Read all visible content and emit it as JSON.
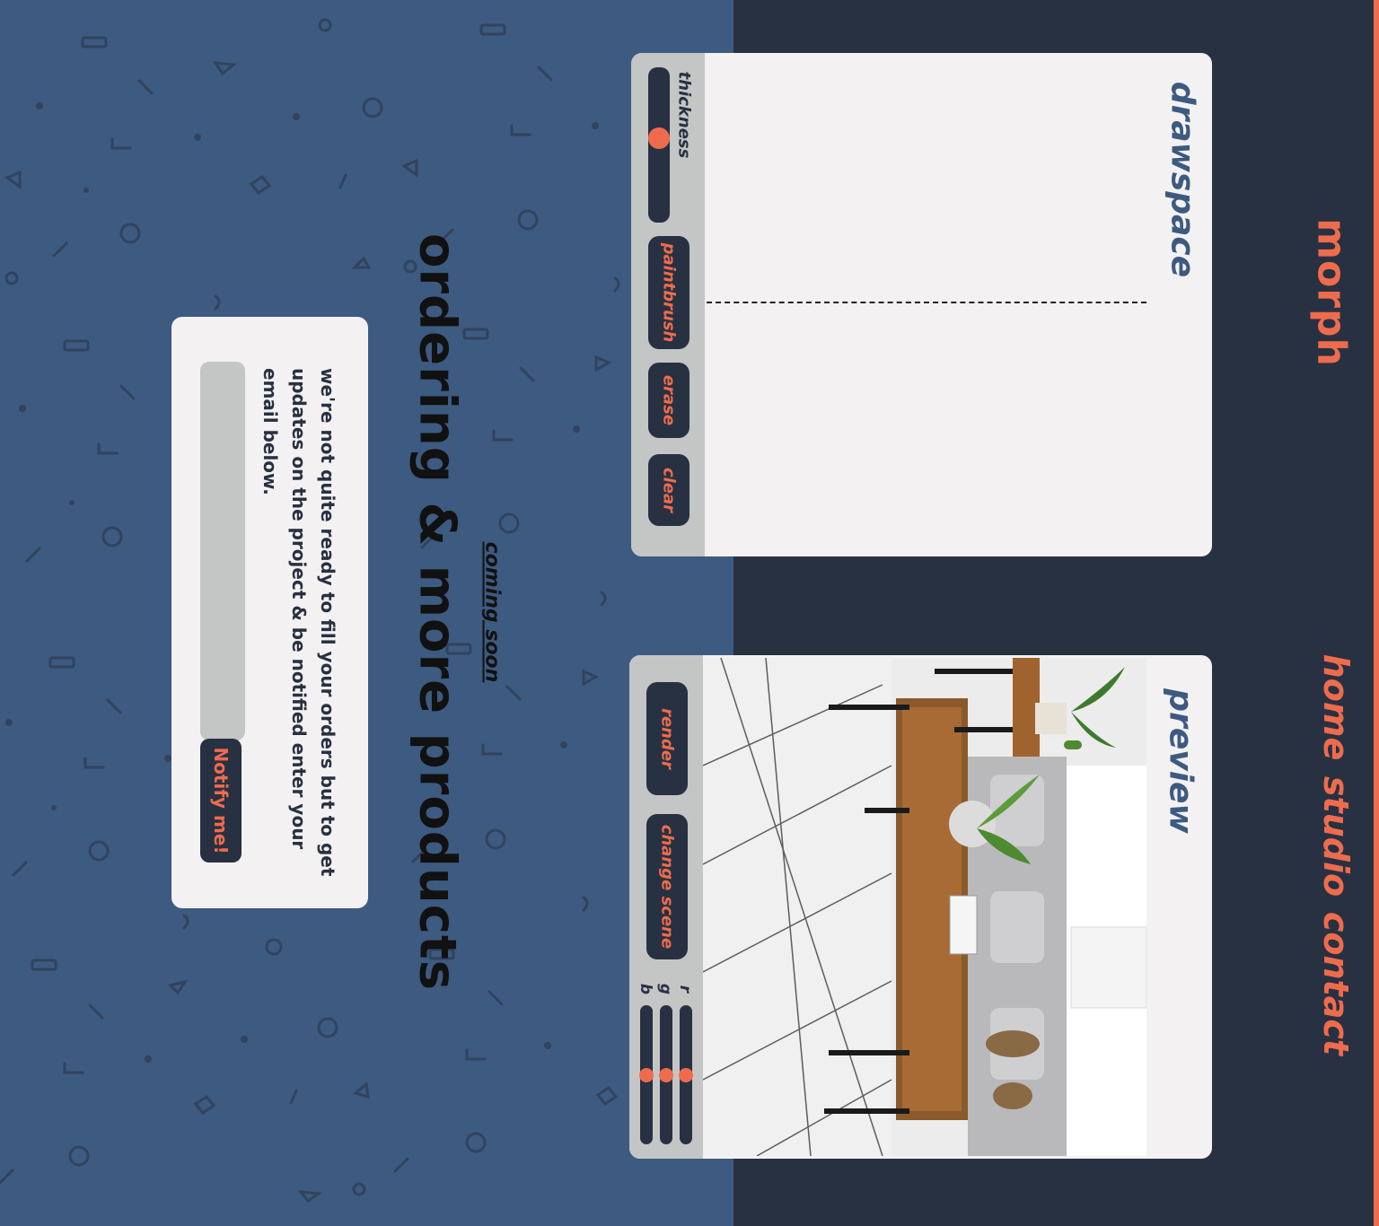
{
  "brand": {
    "logo": "morph",
    "accent": "#ee6c4d",
    "dark": "#283142",
    "blue": "#3d5a80",
    "light": "#f3f1f2"
  },
  "nav": {
    "home": "home",
    "studio": "studio",
    "contact": "contact"
  },
  "drawspace": {
    "title": "drawspace",
    "thickness_label": "thickness",
    "thickness_value": 0.45,
    "tools": {
      "paintbrush": "paintbrush",
      "erase": "erase",
      "clear": "clear"
    }
  },
  "preview": {
    "title": "preview",
    "render": "render",
    "change_scene": "change scene",
    "rgb": {
      "r": "r",
      "g": "g",
      "b": "b"
    },
    "rgb_values": {
      "r": 0.5,
      "g": 0.5,
      "b": 0.5
    }
  },
  "coming_soon": {
    "label": "coming soon",
    "headline": "ordering & more products",
    "body": "we're not quite ready to fill your orders but to get updates on the project & be notified enter your email below.",
    "email_placeholder": "",
    "button": "Notify me!"
  }
}
